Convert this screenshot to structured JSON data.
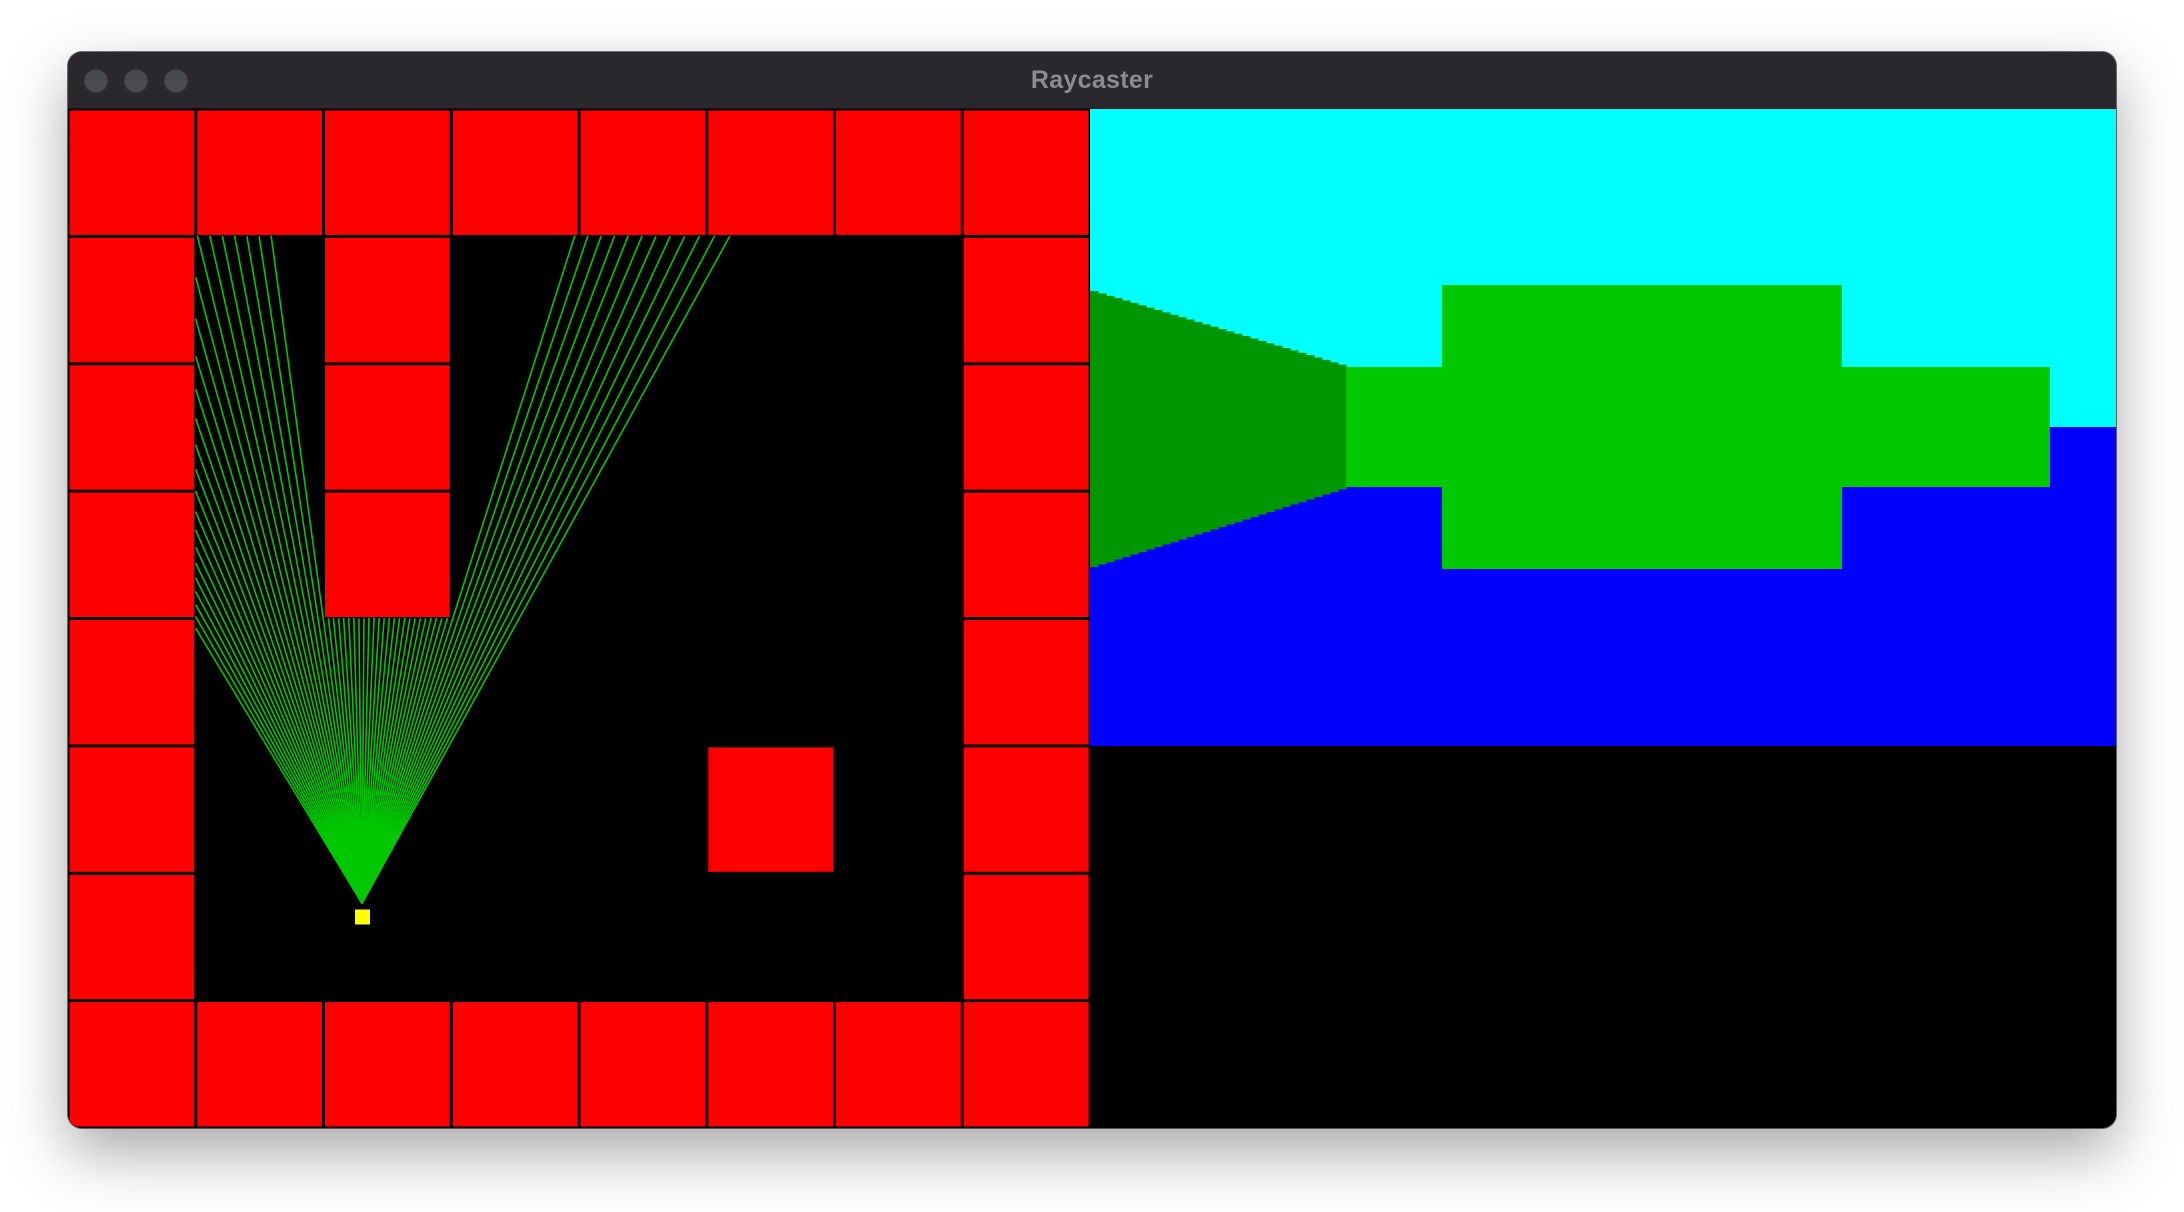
{
  "window": {
    "title": "Raycaster"
  },
  "colors": {
    "wall": "#ff0000",
    "floor_grid": "#000000",
    "ray": "#00c800",
    "player": "#ffff00",
    "sky": "#00ffff",
    "ground": "#0000ff",
    "wall_near": "#00c800",
    "wall_shaded": "#009600",
    "view_background": "#000000"
  },
  "map": {
    "cols": 8,
    "rows": 8,
    "cells": [
      [
        1,
        1,
        1,
        1,
        1,
        1,
        1,
        1
      ],
      [
        1,
        0,
        1,
        0,
        0,
        0,
        0,
        1
      ],
      [
        1,
        0,
        1,
        0,
        0,
        0,
        0,
        1
      ],
      [
        1,
        0,
        1,
        0,
        0,
        0,
        0,
        1
      ],
      [
        1,
        0,
        0,
        0,
        0,
        0,
        0,
        1
      ],
      [
        1,
        0,
        0,
        0,
        0,
        1,
        0,
        1
      ],
      [
        1,
        0,
        0,
        0,
        0,
        0,
        0,
        1
      ],
      [
        1,
        1,
        1,
        1,
        1,
        1,
        1,
        1
      ]
    ],
    "player": {
      "col": 2.38,
      "row": 6.3
    },
    "fov_degrees": 60
  },
  "view3d": {
    "description_hidden": true
  }
}
